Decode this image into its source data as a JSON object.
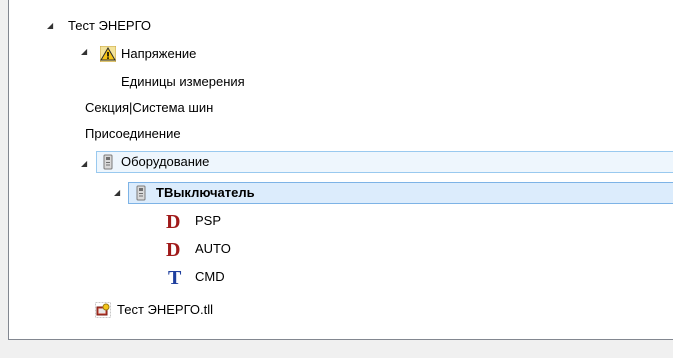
{
  "tree": {
    "root_label": "Тест ЭНЕРГО",
    "voltage_label": "Напряжение",
    "units_label": "Единицы измерения",
    "section_label": "Секция|Система шин",
    "connection_label": "Присоединение",
    "equipment_label": "Оборудование",
    "breaker_label": "ТВыключатель",
    "breaker_children": [
      {
        "glyph": "D",
        "label": "PSP",
        "color": "#a01a1a"
      },
      {
        "glyph": "D",
        "label": "AUTO",
        "color": "#a01a1a"
      },
      {
        "glyph": "T",
        "label": "CMD",
        "color": "#1f3f9e"
      }
    ],
    "file_label": "Тест ЭНЕРГО.tll"
  },
  "colors": {
    "warning_yellow": "#f5c518",
    "selection_fill": "#dcecfc",
    "selection_border": "#7db3e6"
  },
  "icons": {
    "expander": "triangle-expanded",
    "voltage": "warning-icon",
    "equipment": "device-icon",
    "file": "project-file-icon"
  }
}
